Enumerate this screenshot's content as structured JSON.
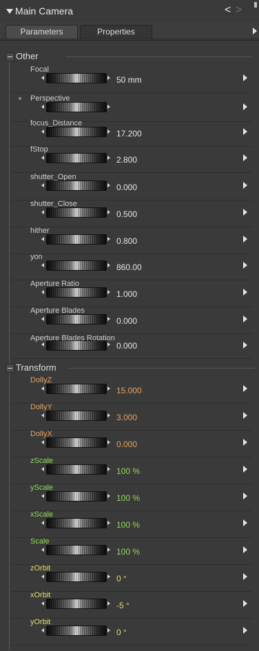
{
  "header": {
    "title": "Main Camera",
    "prev_glyph": "<",
    "next_glyph": ">"
  },
  "tabs": [
    {
      "label": "Parameters"
    },
    {
      "label": "Properties"
    }
  ],
  "groups": {
    "other": {
      "label": "Other"
    },
    "transform": {
      "label": "Transform"
    }
  },
  "params": [
    {
      "name": "Focal",
      "value": "50 mm"
    },
    {
      "name": "Perspective",
      "value": ""
    },
    {
      "name": "focus_Distance",
      "value": "17.200"
    },
    {
      "name": "fStop",
      "value": "2.800"
    },
    {
      "name": "shutter_Open",
      "value": "0.000"
    },
    {
      "name": "shutter_Close",
      "value": "0.500"
    },
    {
      "name": "hither",
      "value": "0.800"
    },
    {
      "name": "yon",
      "value": "860.00"
    },
    {
      "name": "Aperture Ratio",
      "value": "1.000"
    },
    {
      "name": "Aperture Blades",
      "value": "0.000"
    },
    {
      "name": "Aperture Blades Rotation",
      "value": "0.000"
    },
    {
      "name": "DollyZ",
      "value": "15.000"
    },
    {
      "name": "DollyY",
      "value": "3.000"
    },
    {
      "name": "DollyX",
      "value": "0.000"
    },
    {
      "name": "zScale",
      "value": "100 %"
    },
    {
      "name": "yScale",
      "value": "100 %"
    },
    {
      "name": "xScale",
      "value": "100 %"
    },
    {
      "name": "Scale",
      "value": "100 %"
    },
    {
      "name": "zOrbit",
      "value": "0 °"
    },
    {
      "name": "xOrbit",
      "value": "-5 °"
    },
    {
      "name": "yOrbit",
      "value": "0 °"
    }
  ],
  "colors": {
    "panel_bg": "#3a3a3a",
    "dolly_label": "#e8a25e",
    "scale_label": "#8fdb5a",
    "orbit_label": "#e4dc68"
  }
}
